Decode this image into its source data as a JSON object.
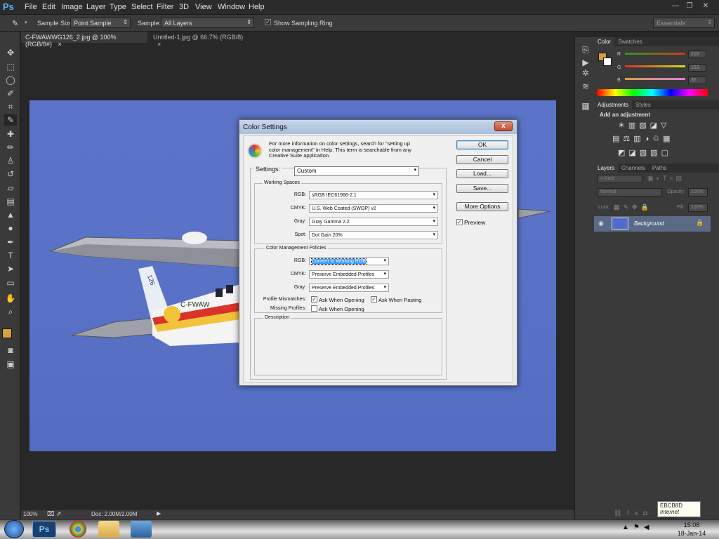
{
  "app": {
    "logo": "Ps"
  },
  "menu": [
    "File",
    "Edit",
    "Image",
    "Layer",
    "Type",
    "Select",
    "Filter",
    "3D",
    "View",
    "Window",
    "Help"
  ],
  "window_buttons": {
    "minimize": "—",
    "restore": "❐",
    "close": "✕"
  },
  "options_bar": {
    "sample_size_label": "Sample Size:",
    "sample_size_value": "Point Sample",
    "sample_label": "Sample:",
    "sample_value": "All Layers",
    "show_ring_label": "Show Sampling Ring",
    "workspace": "Essentials"
  },
  "doc_tabs": [
    {
      "label": "C-FWAWWG126_2.jpg @ 100% (RGB/8#)",
      "close": "×"
    },
    {
      "label": "Untitled-1.jpg @ 66.7% (RGB/8)",
      "close": "×"
    }
  ],
  "status": {
    "zoom": "100%",
    "doc": "Doc: 2.00M/2.00M"
  },
  "color_panel": {
    "tabs": [
      "Color",
      "Swatches"
    ],
    "fg_color": "#d7a03f",
    "channels": [
      {
        "label": "R",
        "value": "218"
      },
      {
        "label": "G",
        "value": "153"
      },
      {
        "label": "B",
        "value": "35"
      }
    ]
  },
  "adjustments_panel": {
    "tabs": [
      "Adjustments",
      "Styles"
    ],
    "heading": "Add an adjustment"
  },
  "layers_panel": {
    "tabs": [
      "Layers",
      "Channels",
      "Paths"
    ],
    "kind": "Kind",
    "blend": "Normal",
    "opacity_label": "Opacity:",
    "opacity_value": "100%",
    "lock_label": "Lock:",
    "fill_label": "Fill:",
    "fill_value": "100%",
    "layer_name": "Background"
  },
  "dialog": {
    "title": "Color Settings",
    "close": "x",
    "info": "For more information on color settings, search for \"setting up color management\" in Help. This term is searchable from any Creative Suite application.",
    "settings_label": "Settings:",
    "settings_value": "Custom",
    "working_spaces": {
      "title": "Working Spaces",
      "rgb_label": "RGB:",
      "rgb": "sRGB IEC61966-2.1",
      "cmyk_label": "CMYK:",
      "cmyk": "U.S. Web Coated (SWOP) v2",
      "gray_label": "Gray:",
      "gray": "Gray Gamma 2.2",
      "spot_label": "Spot:",
      "spot": "Dot Gain 20%"
    },
    "policies": {
      "title": "Color Management Policies",
      "rgb_label": "RGB:",
      "rgb": "Convert to Working RGB",
      "cmyk_label": "CMYK:",
      "cmyk": "Preserve Embedded Profiles",
      "gray_label": "Gray:",
      "gray": "Preserve Embedded Profiles",
      "mismatch_label": "Profile Mismatches:",
      "ask_opening": "Ask When Opening",
      "ask_pasting": "Ask When Pasting",
      "missing_label": "Missing Profiles:",
      "missing_ask_opening": "Ask When Opening"
    },
    "description_title": "Description",
    "buttons": {
      "ok": "OK",
      "cancel": "Cancel",
      "load": "Load...",
      "save": "Save...",
      "more": "More Options"
    },
    "preview": "Preview"
  },
  "tooltip": {
    "line1": "EBCB8D",
    "line2": "Internet access"
  },
  "clock": {
    "time": "15:08",
    "date": "18-Jan-14"
  },
  "plane": {
    "registration": "C-FWAW",
    "tail_number": "126"
  }
}
